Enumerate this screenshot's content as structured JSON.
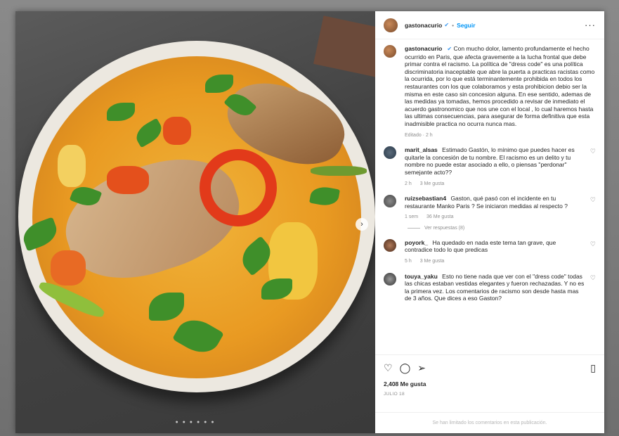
{
  "header": {
    "username": "gastonacurio",
    "verified_icon": "verified-badge-icon",
    "separator": "•",
    "follow_label": "Seguir",
    "more_label": "···"
  },
  "caption": {
    "username": "gastonacurio",
    "text": "Con mucho dolor, lamento profundamente el hecho ocurrido en Paris, que afecta gravemente a la lucha frontal que debe primar contra el racismo. La política de \"dress code\" es una política discriminatoria inaceptable que abre la puerta a practicas racistas como la ocurrida, por lo que está terminantemente prohibida en todos los restaurantes con los que colaboramos y esta prohibicion debio ser la misma en este caso sin concesion alguna. En ese sentido, ademas de las medidas ya tomadas, hemos procedido a revisar de inmediato el acuerdo gastronomico que nos une con el local , lo cual haremos hasta las ultimas consecuencias, para asegurar de forma definitiva que esta inadmisible practica no ocurra nunca mas.",
    "meta": "Editado · 2 h"
  },
  "comments": [
    {
      "username": "marit_alsas",
      "text": "Estimado Gastón, lo mínimo que puedes hacer es quitarle la concesión de tu nombre. El racismo es un delito y tu nombre no puede estar asociado a ello, o piensas \"perdonar\" semejante acto??",
      "time": "2 h",
      "likes": "3 Me gusta"
    },
    {
      "username": "ruizsebastian4",
      "text": "Gaston, qué pasó con el incidente en tu restaurante Manko Paris ? Se iniciaron medidas al respecto ?",
      "time": "1 sem",
      "likes": "36 Me gusta",
      "replies": "Ver respuestas (8)"
    },
    {
      "username": "poyork_",
      "text": "Ha quedado en nada este tema tan grave, que contradice todo lo que predicas",
      "time": "5 h",
      "likes": "3 Me gusta"
    },
    {
      "username": "touya_yaku",
      "text": "Esto no tiene nada que ver con el \"dress code\" todas las chicas estaban vestidas elegantes y fueron rechazadas. Y no es la primera vez. Los comentarios de racismo son desde hasta mas de 3 años. Que dices a eso Gaston?",
      "time": "",
      "likes": ""
    }
  ],
  "actions": {
    "like_icon": "heart-icon",
    "comment_icon": "comment-icon",
    "share_icon": "share-icon",
    "save_icon": "bookmark-icon",
    "likes_count": "2,408 Me gusta",
    "date": "JULIO 18"
  },
  "footer": {
    "text": "Se han limitado los comentarios en esta publicación."
  },
  "carousel": {
    "dots": "● ● ● ● ● ●",
    "next_label": "›"
  }
}
